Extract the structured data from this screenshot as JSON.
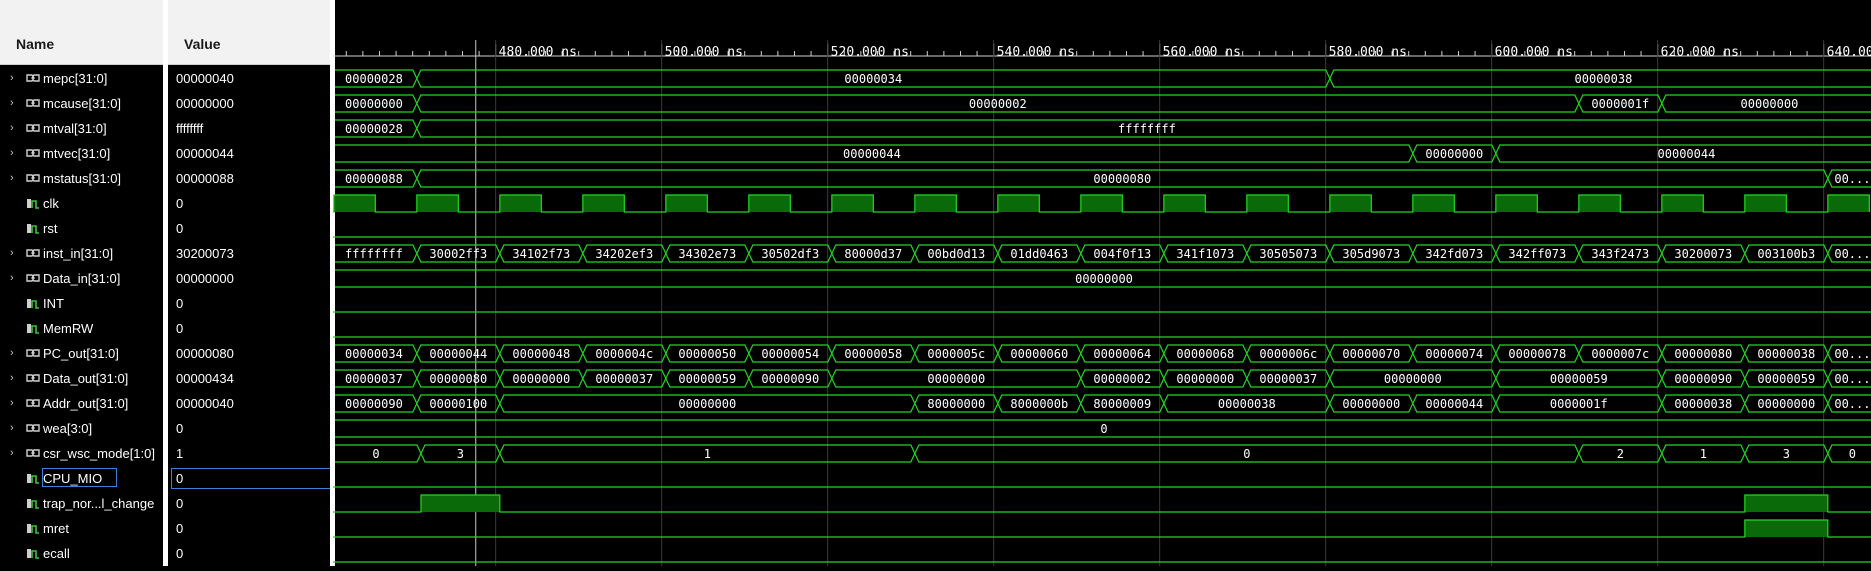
{
  "headers": {
    "name": "Name",
    "value": "Value"
  },
  "colors": {
    "wave": "#22d622",
    "fill": "#0a6a0a",
    "text": "#ffffff",
    "cursor": "#c8c8c8"
  },
  "timeline": {
    "unit": "ns",
    "start": 460.4,
    "end": 642.7,
    "ticks": [
      {
        "t": 480,
        "label": "480.000 ns"
      },
      {
        "t": 500,
        "label": "500.000 ns"
      },
      {
        "t": 520,
        "label": "520.000 ns"
      },
      {
        "t": 540,
        "label": "540.000 ns"
      },
      {
        "t": 560,
        "label": "560.000 ns"
      },
      {
        "t": 580,
        "label": "580.000 ns"
      },
      {
        "t": 600,
        "label": "600.000 ns"
      },
      {
        "t": 620,
        "label": "620.000 ns"
      },
      {
        "t": 640,
        "label": "640.000 ns"
      }
    ],
    "cursor_t": 477.6
  },
  "signals": [
    {
      "name": "mepc[31:0]",
      "value": "00000040",
      "bus": true,
      "segments": [
        {
          "t": 460.4,
          "v": "00000028"
        },
        {
          "t": 470.5,
          "v": "00000034"
        },
        {
          "t": 580.5,
          "v": "00000038"
        }
      ]
    },
    {
      "name": "mcause[31:0]",
      "value": "00000000",
      "bus": true,
      "segments": [
        {
          "t": 460.4,
          "v": "00000000"
        },
        {
          "t": 470.5,
          "v": "00000002"
        },
        {
          "t": 610.5,
          "v": "0000001f"
        },
        {
          "t": 620.5,
          "v": "00000000"
        }
      ]
    },
    {
      "name": "mtval[31:0]",
      "value": "ffffffff",
      "bus": true,
      "segments": [
        {
          "t": 460.4,
          "v": "00000028"
        },
        {
          "t": 470.5,
          "v": "ffffffff"
        }
      ]
    },
    {
      "name": "mtvec[31:0]",
      "value": "00000044",
      "bus": true,
      "segments": [
        {
          "t": 460.4,
          "v": "00000044"
        },
        {
          "t": 590.5,
          "v": "00000000"
        },
        {
          "t": 600.5,
          "v": "00000044"
        }
      ]
    },
    {
      "name": "mstatus[31:0]",
      "value": "00000088",
      "bus": true,
      "segments": [
        {
          "t": 460.4,
          "v": "00000088"
        },
        {
          "t": 470.5,
          "v": "00000080"
        },
        {
          "t": 640.5,
          "v": "00..."
        }
      ]
    },
    {
      "name": "clk",
      "value": "0",
      "bus": false,
      "clock": true
    },
    {
      "name": "rst",
      "value": "0",
      "bus": false,
      "level": 0
    },
    {
      "name": "inst_in[31:0]",
      "value": "30200073",
      "bus": true,
      "segments": [
        {
          "t": 460.4,
          "v": "ffffffff"
        },
        {
          "t": 470.5,
          "v": "30002ff3"
        },
        {
          "t": 480.5,
          "v": "34102f73"
        },
        {
          "t": 490.5,
          "v": "34202ef3"
        },
        {
          "t": 500.5,
          "v": "34302e73"
        },
        {
          "t": 510.5,
          "v": "30502df3"
        },
        {
          "t": 520.5,
          "v": "80000d37"
        },
        {
          "t": 530.5,
          "v": "00bd0d13"
        },
        {
          "t": 540.5,
          "v": "01dd0463"
        },
        {
          "t": 550.5,
          "v": "004f0f13"
        },
        {
          "t": 560.5,
          "v": "341f1073"
        },
        {
          "t": 570.5,
          "v": "30505073"
        },
        {
          "t": 580.5,
          "v": "305d9073"
        },
        {
          "t": 590.5,
          "v": "342fd073"
        },
        {
          "t": 600.5,
          "v": "342ff073"
        },
        {
          "t": 610.5,
          "v": "343f2473"
        },
        {
          "t": 620.5,
          "v": "30200073"
        },
        {
          "t": 630.5,
          "v": "003100b3"
        },
        {
          "t": 640.5,
          "v": "00..."
        }
      ]
    },
    {
      "name": "Data_in[31:0]",
      "value": "00000000",
      "bus": true,
      "segments": [
        {
          "t": 460.4,
          "v": "00000000"
        }
      ]
    },
    {
      "name": "INT",
      "value": "0",
      "bus": false,
      "level": 0
    },
    {
      "name": "MemRW",
      "value": "0",
      "bus": false,
      "level": 0
    },
    {
      "name": "PC_out[31:0]",
      "value": "00000080",
      "bus": true,
      "segments": [
        {
          "t": 460.4,
          "v": "00000034"
        },
        {
          "t": 470.5,
          "v": "00000044"
        },
        {
          "t": 480.5,
          "v": "00000048"
        },
        {
          "t": 490.5,
          "v": "0000004c"
        },
        {
          "t": 500.5,
          "v": "00000050"
        },
        {
          "t": 510.5,
          "v": "00000054"
        },
        {
          "t": 520.5,
          "v": "00000058"
        },
        {
          "t": 530.5,
          "v": "0000005c"
        },
        {
          "t": 540.5,
          "v": "00000060"
        },
        {
          "t": 550.5,
          "v": "00000064"
        },
        {
          "t": 560.5,
          "v": "00000068"
        },
        {
          "t": 570.5,
          "v": "0000006c"
        },
        {
          "t": 580.5,
          "v": "00000070"
        },
        {
          "t": 590.5,
          "v": "00000074"
        },
        {
          "t": 600.5,
          "v": "00000078"
        },
        {
          "t": 610.5,
          "v": "0000007c"
        },
        {
          "t": 620.5,
          "v": "00000080"
        },
        {
          "t": 630.5,
          "v": "00000038"
        },
        {
          "t": 640.5,
          "v": "00..."
        }
      ]
    },
    {
      "name": "Data_out[31:0]",
      "value": "00000434",
      "bus": true,
      "segments": [
        {
          "t": 460.4,
          "v": "00000037"
        },
        {
          "t": 470.5,
          "v": "00000080"
        },
        {
          "t": 480.5,
          "v": "00000000"
        },
        {
          "t": 490.5,
          "v": "00000037"
        },
        {
          "t": 500.5,
          "v": "00000059"
        },
        {
          "t": 510.5,
          "v": "00000090"
        },
        {
          "t": 520.5,
          "v": "00000000"
        },
        {
          "t": 550.5,
          "v": "00000002"
        },
        {
          "t": 560.5,
          "v": "00000000"
        },
        {
          "t": 570.5,
          "v": "00000037"
        },
        {
          "t": 580.5,
          "v": "00000000"
        },
        {
          "t": 600.5,
          "v": "00000059"
        },
        {
          "t": 620.5,
          "v": "00000090"
        },
        {
          "t": 630.5,
          "v": "00000059"
        },
        {
          "t": 640.5,
          "v": "00..."
        }
      ]
    },
    {
      "name": "Addr_out[31:0]",
      "value": "00000040",
      "bus": true,
      "segments": [
        {
          "t": 460.4,
          "v": "00000090"
        },
        {
          "t": 470.5,
          "v": "00000100"
        },
        {
          "t": 480.5,
          "v": "00000000"
        },
        {
          "t": 530.5,
          "v": "80000000"
        },
        {
          "t": 540.5,
          "v": "8000000b"
        },
        {
          "t": 550.5,
          "v": "80000009"
        },
        {
          "t": 560.5,
          "v": "00000038"
        },
        {
          "t": 580.5,
          "v": "00000000"
        },
        {
          "t": 590.5,
          "v": "00000044"
        },
        {
          "t": 600.5,
          "v": "0000001f"
        },
        {
          "t": 620.5,
          "v": "00000038"
        },
        {
          "t": 630.5,
          "v": "00000000"
        },
        {
          "t": 640.5,
          "v": "00..."
        }
      ]
    },
    {
      "name": "wea[3:0]",
      "value": "0",
      "bus": true,
      "segments": [
        {
          "t": 460.4,
          "v": "0"
        }
      ]
    },
    {
      "name": "csr_wsc_mode[1:0]",
      "value": "1",
      "bus": true,
      "segments": [
        {
          "t": 460.4,
          "v": "0"
        },
        {
          "t": 471.0,
          "v": "3"
        },
        {
          "t": 480.5,
          "v": "1"
        },
        {
          "t": 530.5,
          "v": "0"
        },
        {
          "t": 610.5,
          "v": "2"
        },
        {
          "t": 620.5,
          "v": "1"
        },
        {
          "t": 630.5,
          "v": "3"
        },
        {
          "t": 640.5,
          "v": "0"
        }
      ]
    },
    {
      "name": "CPU_MIO",
      "value": "0",
      "bus": false,
      "level": 0,
      "selected": true
    },
    {
      "name": "trap_nor...l_change",
      "value": "0",
      "bus": false,
      "pulses": [
        [
          471.0,
          480.5
        ],
        [
          630.5,
          640.5
        ]
      ]
    },
    {
      "name": "mret",
      "value": "0",
      "bus": false,
      "pulses": [
        [
          630.5,
          640.5
        ]
      ]
    },
    {
      "name": "ecall",
      "value": "0",
      "bus": false,
      "level": 0
    }
  ]
}
